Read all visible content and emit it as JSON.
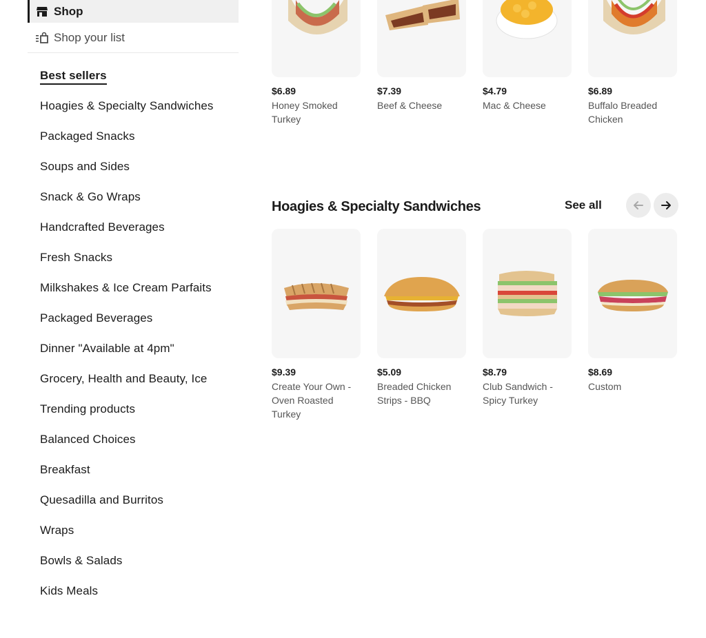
{
  "sidebar": {
    "shop_label": "Shop",
    "list_label": "Shop your list",
    "categories": [
      "Best sellers",
      "Hoagies & Specialty Sandwiches",
      "Packaged Snacks",
      "Soups and Sides",
      "Snack & Go Wraps",
      "Handcrafted Beverages",
      "Fresh Snacks",
      "Milkshakes & Ice Cream Parfaits",
      "Packaged Beverages",
      "Dinner \"Available at 4pm\"",
      "Grocery, Health and Beauty, Ice",
      "Trending products",
      "Balanced Choices",
      "Breakfast",
      "Quesadilla and Burritos",
      "Wraps",
      "Bowls & Salads",
      "Kids Meals"
    ]
  },
  "best_sellers_row": [
    {
      "price": "$6.89",
      "name": "Honey Smoked Turkey"
    },
    {
      "price": "$7.39",
      "name": "Beef & Cheese"
    },
    {
      "price": "$4.79",
      "name": "Mac & Cheese"
    },
    {
      "price": "$6.89",
      "name": "Buffalo Breaded Chicken"
    }
  ],
  "hoagies": {
    "title": "Hoagies & Specialty Sandwiches",
    "see_all": "See all",
    "items": [
      {
        "price": "$9.39",
        "name": "Create Your Own - Oven Roasted Turkey"
      },
      {
        "price": "$5.09",
        "name": "Breaded Chicken Strips - BBQ"
      },
      {
        "price": "$8.79",
        "name": "Club Sandwich - Spicy Turkey"
      },
      {
        "price": "$8.69",
        "name": "Custom"
      }
    ]
  },
  "colors": {
    "text": "#1b1b1b",
    "muted": "#555555",
    "thumb_bg": "#f6f6f6",
    "active_bg": "#f0f0f0"
  }
}
